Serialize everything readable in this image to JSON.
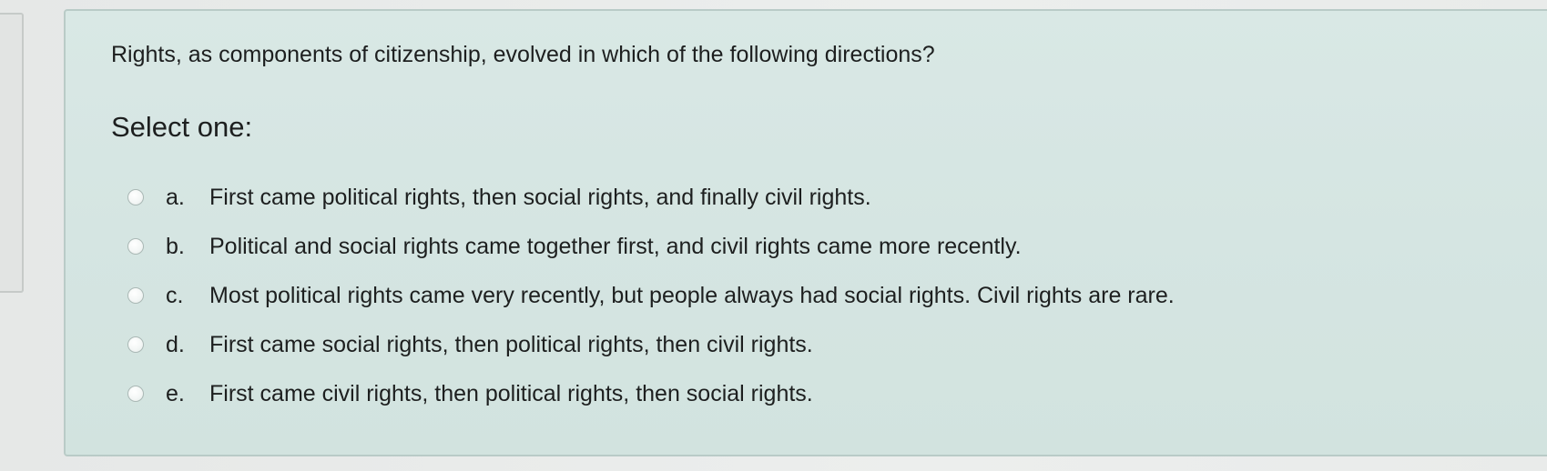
{
  "quiz": {
    "question": "Rights, as components of citizenship, evolved in which of the following directions?",
    "prompt": "Select one:",
    "options": [
      {
        "letter": "a.",
        "text": "First came political rights, then social rights, and finally civil rights."
      },
      {
        "letter": "b.",
        "text": "Political and social rights came together first, and civil rights came more recently."
      },
      {
        "letter": "c.",
        "text": "Most political rights came very recently, but people always had social rights. Civil rights are rare."
      },
      {
        "letter": "d.",
        "text": "First came social rights, then political rights, then civil rights."
      },
      {
        "letter": "e.",
        "text": "First came civil rights, then political rights, then social rights."
      }
    ]
  }
}
